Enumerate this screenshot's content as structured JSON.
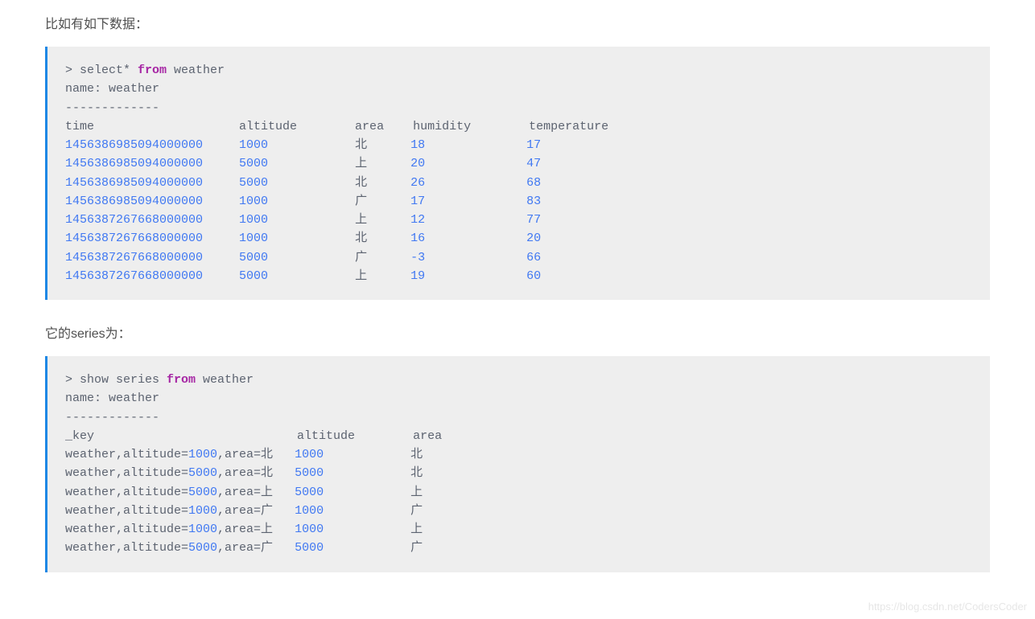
{
  "intro1": "比如有如下数据：",
  "intro2": "它的series为：",
  "watermark": "https://blog.csdn.net/CodersCoder",
  "block1": {
    "prompt": "> ",
    "query": {
      "pre": "select* ",
      "kw": "from",
      "post": " weather"
    },
    "nameLine": "name: weather",
    "dash": "-------------",
    "headers": [
      "time",
      "altitude",
      "area",
      "humidity",
      "temperature"
    ],
    "rows": [
      {
        "time": "1456386985094000000",
        "altitude": "1000",
        "area": "北",
        "humidity": "18",
        "temperature": "17"
      },
      {
        "time": "1456386985094000000",
        "altitude": "5000",
        "area": "上",
        "humidity": "20",
        "temperature": "47"
      },
      {
        "time": "1456386985094000000",
        "altitude": "5000",
        "area": "北",
        "humidity": "26",
        "temperature": "68"
      },
      {
        "time": "1456386985094000000",
        "altitude": "1000",
        "area": "广",
        "humidity": "17",
        "temperature": "83"
      },
      {
        "time": "1456387267668000000",
        "altitude": "1000",
        "area": "上",
        "humidity": "12",
        "temperature": "77"
      },
      {
        "time": "1456387267668000000",
        "altitude": "1000",
        "area": "北",
        "humidity": "16",
        "temperature": "20"
      },
      {
        "time": "1456387267668000000",
        "altitude": "5000",
        "area": "广",
        "humidity": "-3",
        "temperature": "66"
      },
      {
        "time": "1456387267668000000",
        "altitude": "5000",
        "area": "上",
        "humidity": "19",
        "temperature": "60"
      }
    ]
  },
  "block2": {
    "prompt": "> ",
    "query": {
      "pre": "show series ",
      "kw": "from",
      "post": " weather"
    },
    "nameLine": "name: weather",
    "dash": "-------------",
    "headers": [
      "_key",
      "altitude",
      "area"
    ],
    "rows": [
      {
        "key_prefix": "weather,altitude=",
        "key_alt": "1000",
        "key_mid": ",area=北",
        "altitude": "1000",
        "area": "北"
      },
      {
        "key_prefix": "weather,altitude=",
        "key_alt": "5000",
        "key_mid": ",area=北",
        "altitude": "5000",
        "area": "北"
      },
      {
        "key_prefix": "weather,altitude=",
        "key_alt": "5000",
        "key_mid": ",area=上",
        "altitude": "5000",
        "area": "上"
      },
      {
        "key_prefix": "weather,altitude=",
        "key_alt": "1000",
        "key_mid": ",area=广",
        "altitude": "1000",
        "area": "广"
      },
      {
        "key_prefix": "weather,altitude=",
        "key_alt": "1000",
        "key_mid": ",area=上",
        "altitude": "1000",
        "area": "上"
      },
      {
        "key_prefix": "weather,altitude=",
        "key_alt": "5000",
        "key_mid": ",area=广",
        "altitude": "5000",
        "area": "广"
      }
    ]
  }
}
